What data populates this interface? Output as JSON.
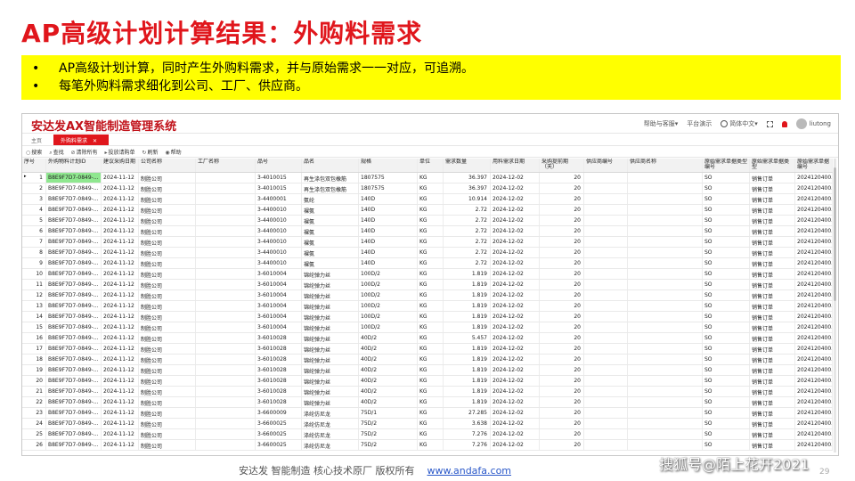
{
  "slide": {
    "title": "AP高级计划计算结果：外购料需求",
    "bullets": [
      "AP高级计划计算，同时产生外购料需求，并与原始需求一一对应，可追溯。",
      "每笔外购料需求细化到公司、工厂、供应商。"
    ],
    "bullet_symbol": "•",
    "footer_text": "安达发   智能制造 核心技术原厂    版权所有",
    "footer_link": "www.andafa.com",
    "watermark": "搜狐号@陌上花开2021",
    "page_number": "29"
  },
  "app": {
    "title": "安达发AX智能制造管理系统",
    "header": {
      "help": "帮助与客服▾",
      "platform": "平台演示",
      "language": "简体中文▾",
      "user": "liutong"
    },
    "tabs": {
      "home": "主页",
      "active": "外购料需求",
      "close": "✕"
    },
    "toolbar": [
      {
        "icon": "○",
        "label": "搜索"
      },
      {
        "icon": "⌕",
        "label": "查找"
      },
      {
        "icon": "⊘",
        "label": "清除所有"
      },
      {
        "icon": "▸",
        "label": "投放请购单"
      },
      {
        "icon": "↻",
        "label": "刷新"
      },
      {
        "icon": "◉",
        "label": "帮助"
      }
    ],
    "columns": [
      "序号",
      "外购物料计划ID",
      "建议采购日期",
      "公司名称",
      "工厂名称",
      "品号",
      "品名",
      "规格",
      "单位",
      "需求数量",
      "用料需求日期",
      "采购提前期（天）",
      "供应商编号",
      "供应商名称",
      "原始需求单据类型编号",
      "原始需求单据类型",
      "原始需求单据编号"
    ],
    "rows": [
      [
        "1",
        "B8E9F7D7-0849-...",
        "2024-11-12",
        "制胜公司",
        "",
        "3-4010015",
        "再生涤包双包橡筋",
        "1807575",
        "KG",
        "36.397",
        "2024-12-02",
        "20",
        "",
        "",
        "SO",
        "销售订单",
        "2024120400..."
      ],
      [
        "2",
        "B8E9F7D7-0849-...",
        "2024-11-12",
        "制胜公司",
        "",
        "3-4010015",
        "再生涤包双包橡筋",
        "1807575",
        "KG",
        "36.397",
        "2024-12-02",
        "20",
        "",
        "",
        "SO",
        "销售订单",
        "2024120400..."
      ],
      [
        "3",
        "B8E9F7D7-0849-...",
        "2024-11-12",
        "制胜公司",
        "",
        "3-4400001",
        "氨纶",
        "140D",
        "KG",
        "10.914",
        "2024-12-02",
        "20",
        "",
        "",
        "SO",
        "销售订单",
        "2024120400..."
      ],
      [
        "4",
        "B8E9F7D7-0849-...",
        "2024-11-12",
        "制胜公司",
        "",
        "3-4400010",
        "裸氨",
        "140D",
        "KG",
        "2.72",
        "2024-12-02",
        "20",
        "",
        "",
        "SO",
        "销售订单",
        "2024120400..."
      ],
      [
        "5",
        "B8E9F7D7-0849-...",
        "2024-11-12",
        "制胜公司",
        "",
        "3-4400010",
        "裸氨",
        "140D",
        "KG",
        "2.72",
        "2024-12-02",
        "20",
        "",
        "",
        "SO",
        "销售订单",
        "2024120400..."
      ],
      [
        "6",
        "B8E9F7D7-0849-...",
        "2024-11-12",
        "制胜公司",
        "",
        "3-4400010",
        "裸氨",
        "140D",
        "KG",
        "2.72",
        "2024-12-02",
        "20",
        "",
        "",
        "SO",
        "销售订单",
        "2024120400..."
      ],
      [
        "7",
        "B8E9F7D7-0849-...",
        "2024-11-12",
        "制胜公司",
        "",
        "3-4400010",
        "裸氨",
        "140D",
        "KG",
        "2.72",
        "2024-12-02",
        "20",
        "",
        "",
        "SO",
        "销售订单",
        "2024120400..."
      ],
      [
        "8",
        "B8E9F7D7-0849-...",
        "2024-11-12",
        "制胜公司",
        "",
        "3-4400010",
        "裸氨",
        "140D",
        "KG",
        "2.72",
        "2024-12-02",
        "20",
        "",
        "",
        "SO",
        "销售订单",
        "2024120400..."
      ],
      [
        "9",
        "B8E9F7D7-0849-...",
        "2024-11-12",
        "制胜公司",
        "",
        "3-4400010",
        "裸氨",
        "140D",
        "KG",
        "2.72",
        "2024-12-02",
        "20",
        "",
        "",
        "SO",
        "销售订单",
        "2024120400..."
      ],
      [
        "10",
        "B8E9F7D7-0849-...",
        "2024-11-12",
        "制胜公司",
        "",
        "3-6010004",
        "锦纶弹力丝",
        "100D/2",
        "KG",
        "1.819",
        "2024-12-02",
        "20",
        "",
        "",
        "SO",
        "销售订单",
        "2024120400..."
      ],
      [
        "11",
        "B8E9F7D7-0849-...",
        "2024-11-12",
        "制胜公司",
        "",
        "3-6010004",
        "锦纶弹力丝",
        "100D/2",
        "KG",
        "1.819",
        "2024-12-02",
        "20",
        "",
        "",
        "SO",
        "销售订单",
        "2024120400..."
      ],
      [
        "12",
        "B8E9F7D7-0849-...",
        "2024-11-12",
        "制胜公司",
        "",
        "3-6010004",
        "锦纶弹力丝",
        "100D/2",
        "KG",
        "1.819",
        "2024-12-02",
        "20",
        "",
        "",
        "SO",
        "销售订单",
        "2024120400..."
      ],
      [
        "13",
        "B8E9F7D7-0849-...",
        "2024-11-12",
        "制胜公司",
        "",
        "3-6010004",
        "锦纶弹力丝",
        "100D/2",
        "KG",
        "1.819",
        "2024-12-02",
        "20",
        "",
        "",
        "SO",
        "销售订单",
        "2024120400..."
      ],
      [
        "14",
        "B8E9F7D7-0849-...",
        "2024-11-12",
        "制胜公司",
        "",
        "3-6010004",
        "锦纶弹力丝",
        "100D/2",
        "KG",
        "1.819",
        "2024-12-02",
        "20",
        "",
        "",
        "SO",
        "销售订单",
        "2024120400..."
      ],
      [
        "15",
        "B8E9F7D7-0849-...",
        "2024-11-12",
        "制胜公司",
        "",
        "3-6010004",
        "锦纶弹力丝",
        "100D/2",
        "KG",
        "1.819",
        "2024-12-02",
        "20",
        "",
        "",
        "SO",
        "销售订单",
        "2024120400..."
      ],
      [
        "16",
        "B8E9F7D7-0849-...",
        "2024-11-12",
        "制胜公司",
        "",
        "3-6010028",
        "锦纶弹力丝",
        "40D/2",
        "KG",
        "5.457",
        "2024-12-02",
        "20",
        "",
        "",
        "SO",
        "销售订单",
        "2024120400..."
      ],
      [
        "17",
        "B8E9F7D7-0849-...",
        "2024-11-12",
        "制胜公司",
        "",
        "3-6010028",
        "锦纶弹力丝",
        "40D/2",
        "KG",
        "1.819",
        "2024-12-02",
        "20",
        "",
        "",
        "SO",
        "销售订单",
        "2024120400..."
      ],
      [
        "18",
        "B8E9F7D7-0849-...",
        "2024-11-12",
        "制胜公司",
        "",
        "3-6010028",
        "锦纶弹力丝",
        "40D/2",
        "KG",
        "1.819",
        "2024-12-02",
        "20",
        "",
        "",
        "SO",
        "销售订单",
        "2024120400..."
      ],
      [
        "19",
        "B8E9F7D7-0849-...",
        "2024-11-12",
        "制胜公司",
        "",
        "3-6010028",
        "锦纶弹力丝",
        "40D/2",
        "KG",
        "1.819",
        "2024-12-02",
        "20",
        "",
        "",
        "SO",
        "销售订单",
        "2024120400..."
      ],
      [
        "20",
        "B8E9F7D7-0849-...",
        "2024-11-12",
        "制胜公司",
        "",
        "3-6010028",
        "锦纶弹力丝",
        "40D/2",
        "KG",
        "1.819",
        "2024-12-02",
        "20",
        "",
        "",
        "SO",
        "销售订单",
        "2024120400..."
      ],
      [
        "21",
        "B8E9F7D7-0849-...",
        "2024-11-12",
        "制胜公司",
        "",
        "3-6010028",
        "锦纶弹力丝",
        "40D/2",
        "KG",
        "1.819",
        "2024-12-02",
        "20",
        "",
        "",
        "SO",
        "销售订单",
        "2024120400..."
      ],
      [
        "22",
        "B8E9F7D7-0849-...",
        "2024-11-12",
        "制胜公司",
        "",
        "3-6010028",
        "锦纶弹力丝",
        "40D/2",
        "KG",
        "1.819",
        "2024-12-02",
        "20",
        "",
        "",
        "SO",
        "销售订单",
        "2024120400..."
      ],
      [
        "23",
        "B8E9F7D7-0849-...",
        "2024-11-12",
        "制胜公司",
        "",
        "3-6600009",
        "涤纶仿尼龙",
        "75D/1",
        "KG",
        "27.285",
        "2024-12-02",
        "20",
        "",
        "",
        "SO",
        "销售订单",
        "2024120400..."
      ],
      [
        "24",
        "B8E9F7D7-0849-...",
        "2024-11-12",
        "制胜公司",
        "",
        "3-6600025",
        "涤纶仿尼龙",
        "75D/2",
        "KG",
        "3.638",
        "2024-12-02",
        "20",
        "",
        "",
        "SO",
        "销售订单",
        "2024120400..."
      ],
      [
        "25",
        "B8E9F7D7-0849-...",
        "2024-11-12",
        "制胜公司",
        "",
        "3-6600025",
        "涤纶仿尼龙",
        "75D/2",
        "KG",
        "7.276",
        "2024-12-02",
        "20",
        "",
        "",
        "SO",
        "销售订单",
        "2024120400..."
      ],
      [
        "26",
        "B8E9F7D7-0849-...",
        "2024-11-12",
        "制胜公司",
        "",
        "3-6600025",
        "涤纶仿尼龙",
        "75D/2",
        "KG",
        "7.276",
        "2024-12-02",
        "20",
        "",
        "",
        "SO",
        "销售订单",
        "2024120400..."
      ]
    ],
    "selected_row_marker": "▸"
  },
  "colors": {
    "title_red": "#e0161c",
    "highlight_yellow": "#ffff00",
    "app_title_red": "#c1121a",
    "selected_cell_green": "#8fe78f",
    "link_blue": "#2a58c9"
  }
}
